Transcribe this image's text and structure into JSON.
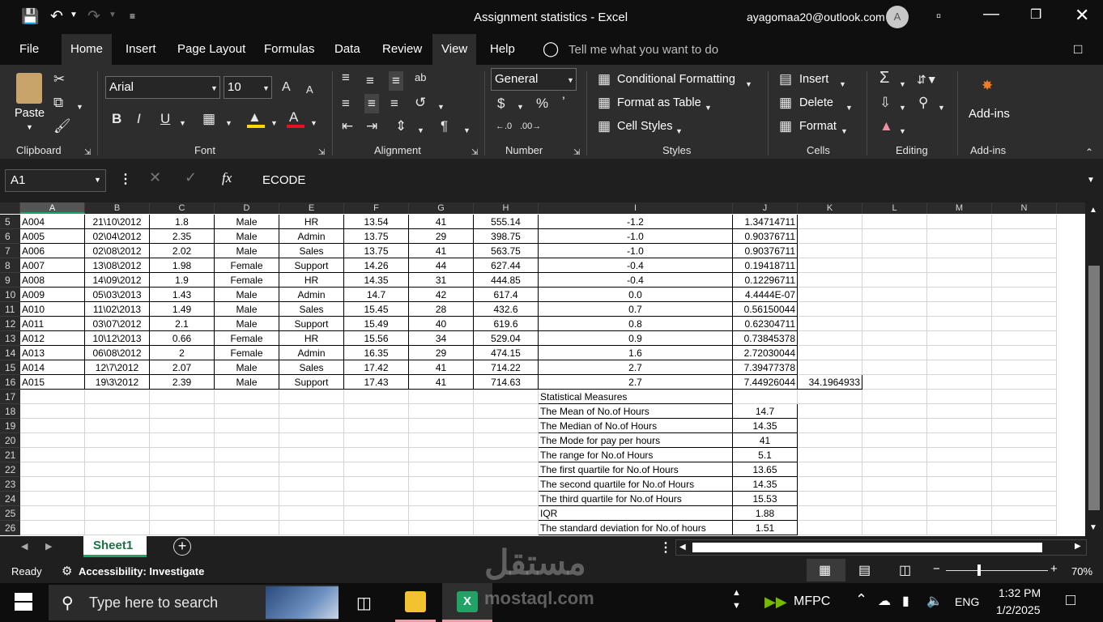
{
  "title": {
    "doc": "Assignment statistics - Excel",
    "account": "ayagomaa20@outlook.com",
    "avatar": "A"
  },
  "menu": [
    "File",
    "Home",
    "Insert",
    "Page Layout",
    "Formulas",
    "Data",
    "Review",
    "View",
    "Help"
  ],
  "tellme": "Tell me what you want to do",
  "ribbon": {
    "paste": "Paste",
    "font_name": "Arial",
    "font_size": "10",
    "number_format": "General",
    "cond_format": "Conditional Formatting",
    "format_table": "Format as Table",
    "cell_styles": "Cell Styles",
    "insert": "Insert",
    "delete": "Delete",
    "format": "Format",
    "addins": "Add-ins",
    "groups": {
      "clipboard": "Clipboard",
      "font": "Font",
      "alignment": "Alignment",
      "number": "Number",
      "styles": "Styles",
      "cells": "Cells",
      "editing": "Editing",
      "addins": "Add-ins"
    }
  },
  "formula_bar": {
    "name_box": "A1",
    "content": "ECODE",
    "fx": "fx"
  },
  "columns": [
    "A",
    "B",
    "C",
    "D",
    "E",
    "F",
    "G",
    "H",
    "I",
    "J",
    "K",
    "L",
    "M",
    "N"
  ],
  "rows": [
    {
      "n": "5",
      "A": "A004",
      "B": "21\\10\\2012",
      "C": "1.8",
      "D": "Male",
      "E": "HR",
      "F": "13.54",
      "G": "41",
      "H": "555.14",
      "I": "-1.2",
      "J": "1.34714711"
    },
    {
      "n": "6",
      "A": "A005",
      "B": "02\\04\\2012",
      "C": "2.35",
      "D": "Male",
      "E": "Admin",
      "F": "13.75",
      "G": "29",
      "H": "398.75",
      "I": "-1.0",
      "J": "0.90376711"
    },
    {
      "n": "7",
      "A": "A006",
      "B": "02\\08\\2012",
      "C": "2.02",
      "D": "Male",
      "E": "Sales",
      "F": "13.75",
      "G": "41",
      "H": "563.75",
      "I": "-1.0",
      "J": "0.90376711"
    },
    {
      "n": "8",
      "A": "A007",
      "B": "13\\08\\2012",
      "C": "1.98",
      "D": "Female",
      "E": "Support",
      "F": "14.26",
      "G": "44",
      "H": "627.44",
      "I": "-0.4",
      "J": "0.19418711"
    },
    {
      "n": "9",
      "A": "A008",
      "B": "14\\09\\2012",
      "C": "1.9",
      "D": "Female",
      "E": "HR",
      "F": "14.35",
      "G": "31",
      "H": "444.85",
      "I": "-0.4",
      "J": "0.12296711"
    },
    {
      "n": "10",
      "A": "A009",
      "B": "05\\03\\2013",
      "C": "1.43",
      "D": "Male",
      "E": "Admin",
      "F": "14.7",
      "G": "42",
      "H": "617.4",
      "I": "0.0",
      "J": "4.4444E-07"
    },
    {
      "n": "11",
      "A": "A010",
      "B": "11\\02\\2013",
      "C": "1.49",
      "D": "Male",
      "E": "Sales",
      "F": "15.45",
      "G": "28",
      "H": "432.6",
      "I": "0.7",
      "J": "0.56150044"
    },
    {
      "n": "12",
      "A": "A011",
      "B": "03\\07\\2012",
      "C": "2.1",
      "D": "Male",
      "E": "Support",
      "F": "15.49",
      "G": "40",
      "H": "619.6",
      "I": "0.8",
      "J": "0.62304711"
    },
    {
      "n": "13",
      "A": "A012",
      "B": "10\\12\\2013",
      "C": "0.66",
      "D": "Female",
      "E": "HR",
      "F": "15.56",
      "G": "34",
      "H": "529.04",
      "I": "0.9",
      "J": "0.73845378"
    },
    {
      "n": "14",
      "A": "A013",
      "B": "06\\08\\2012",
      "C": "2",
      "D": "Female",
      "E": "Admin",
      "F": "16.35",
      "G": "29",
      "H": "474.15",
      "I": "1.6",
      "J": "2.72030044"
    },
    {
      "n": "15",
      "A": "A014",
      "B": "12\\7\\2012",
      "C": "2.07",
      "D": "Male",
      "E": "Sales",
      "F": "17.42",
      "G": "41",
      "H": "714.22",
      "I": "2.7",
      "J": "7.39477378"
    },
    {
      "n": "16",
      "A": "A015",
      "B": "19\\3\\2012",
      "C": "2.39",
      "D": "Male",
      "E": "Support",
      "F": "17.43",
      "G": "41",
      "H": "714.63",
      "I": "2.7",
      "J": "7.44926044",
      "K": "34.1964933"
    }
  ],
  "stats_rows": [
    {
      "n": "17",
      "label": "Statistical Measures",
      "value": ""
    },
    {
      "n": "18",
      "label": "The Mean of No.of Hours",
      "value": "14.7"
    },
    {
      "n": "19",
      "label": "The Median of No.of Hours",
      "value": "14.35"
    },
    {
      "n": "20",
      "label": "The Mode for pay per hours",
      "value": "41"
    },
    {
      "n": "21",
      "label": "The range for No.of Hours",
      "value": "5.1"
    },
    {
      "n": "22",
      "label": "The first quartile for No.of Hours",
      "value": "13.65"
    },
    {
      "n": "23",
      "label": "The second quartile for No.of Hours",
      "value": "14.35"
    },
    {
      "n": "24",
      "label": "The third quartile for No.of Hours",
      "value": "15.53"
    },
    {
      "n": "25",
      "label": "IQR",
      "value": "1.88"
    },
    {
      "n": "26",
      "label": "The standard deviation for No.of hours",
      "value": "1.51"
    }
  ],
  "sheet_tab": "Sheet1",
  "status": {
    "ready": "Ready",
    "accessibility": "Accessibility: Investigate",
    "zoom": "70%"
  },
  "taskbar": {
    "search": "Type here to search",
    "mfpc": "MFPC",
    "lang": "ENG",
    "time": "1:32 PM",
    "date": "1/2/2025"
  },
  "watermark": {
    "arabic": "مستقل",
    "latin": "mostaql.com"
  },
  "colors": {
    "excel_green": "#21a366",
    "accent_red": "#e81123",
    "accent_yellow": "#ffd700"
  }
}
